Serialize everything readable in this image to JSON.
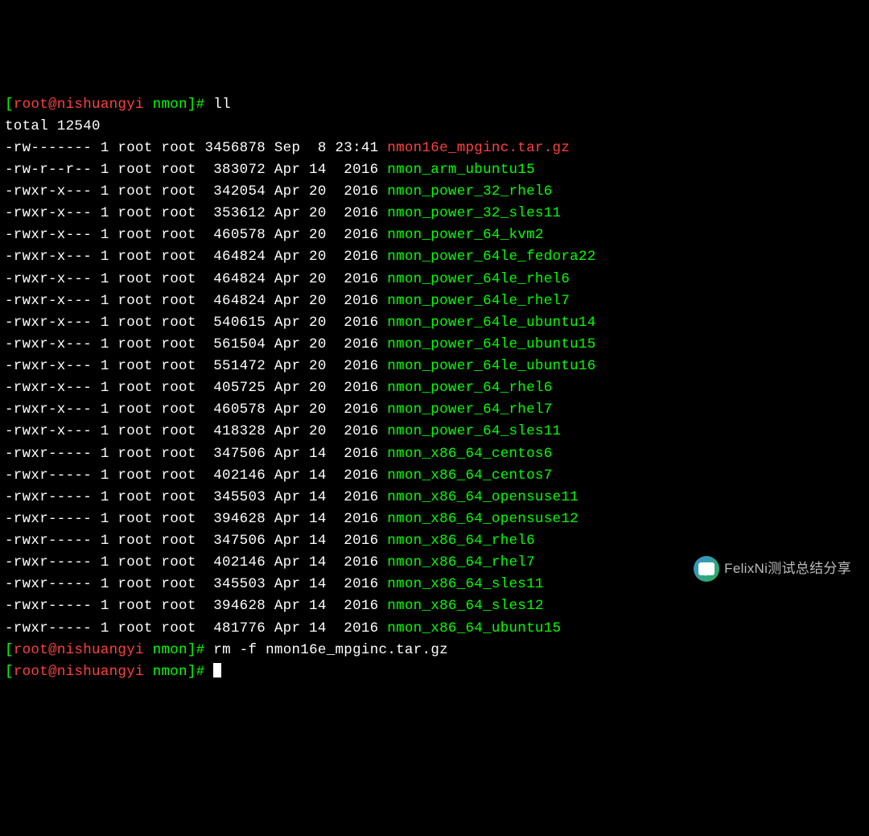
{
  "prompt1_user": "root@nishuangyi",
  "prompt1_dir": "nmon",
  "prompt1_symbol": "#",
  "cmd1": "ll",
  "total_line": "total 12540",
  "files": [
    {
      "perm": "-rw-------",
      "links": "1",
      "owner": "root",
      "group": "root",
      "size": "3456878",
      "month": "Sep",
      "day": " 8",
      "time": "23:41",
      "name": "nmon16e_mpginc.tar.gz",
      "color": "red-file"
    },
    {
      "perm": "-rw-r--r--",
      "links": "1",
      "owner": "root",
      "group": "root",
      "size": " 383072",
      "month": "Apr",
      "day": "14",
      "time": " 2016",
      "name": "nmon_arm_ubuntu15",
      "color": "green"
    },
    {
      "perm": "-rwxr-x---",
      "links": "1",
      "owner": "root",
      "group": "root",
      "size": " 342054",
      "month": "Apr",
      "day": "20",
      "time": " 2016",
      "name": "nmon_power_32_rhel6",
      "color": "green"
    },
    {
      "perm": "-rwxr-x---",
      "links": "1",
      "owner": "root",
      "group": "root",
      "size": " 353612",
      "month": "Apr",
      "day": "20",
      "time": " 2016",
      "name": "nmon_power_32_sles11",
      "color": "green"
    },
    {
      "perm": "-rwxr-x---",
      "links": "1",
      "owner": "root",
      "group": "root",
      "size": " 460578",
      "month": "Apr",
      "day": "20",
      "time": " 2016",
      "name": "nmon_power_64_kvm2",
      "color": "green"
    },
    {
      "perm": "-rwxr-x---",
      "links": "1",
      "owner": "root",
      "group": "root",
      "size": " 464824",
      "month": "Apr",
      "day": "20",
      "time": " 2016",
      "name": "nmon_power_64le_fedora22",
      "color": "green"
    },
    {
      "perm": "-rwxr-x---",
      "links": "1",
      "owner": "root",
      "group": "root",
      "size": " 464824",
      "month": "Apr",
      "day": "20",
      "time": " 2016",
      "name": "nmon_power_64le_rhel6",
      "color": "green"
    },
    {
      "perm": "-rwxr-x---",
      "links": "1",
      "owner": "root",
      "group": "root",
      "size": " 464824",
      "month": "Apr",
      "day": "20",
      "time": " 2016",
      "name": "nmon_power_64le_rhel7",
      "color": "green"
    },
    {
      "perm": "-rwxr-x---",
      "links": "1",
      "owner": "root",
      "group": "root",
      "size": " 540615",
      "month": "Apr",
      "day": "20",
      "time": " 2016",
      "name": "nmon_power_64le_ubuntu14",
      "color": "green"
    },
    {
      "perm": "-rwxr-x---",
      "links": "1",
      "owner": "root",
      "group": "root",
      "size": " 561504",
      "month": "Apr",
      "day": "20",
      "time": " 2016",
      "name": "nmon_power_64le_ubuntu15",
      "color": "green"
    },
    {
      "perm": "-rwxr-x---",
      "links": "1",
      "owner": "root",
      "group": "root",
      "size": " 551472",
      "month": "Apr",
      "day": "20",
      "time": " 2016",
      "name": "nmon_power_64le_ubuntu16",
      "color": "green"
    },
    {
      "perm": "-rwxr-x---",
      "links": "1",
      "owner": "root",
      "group": "root",
      "size": " 405725",
      "month": "Apr",
      "day": "20",
      "time": " 2016",
      "name": "nmon_power_64_rhel6",
      "color": "green"
    },
    {
      "perm": "-rwxr-x---",
      "links": "1",
      "owner": "root",
      "group": "root",
      "size": " 460578",
      "month": "Apr",
      "day": "20",
      "time": " 2016",
      "name": "nmon_power_64_rhel7",
      "color": "green"
    },
    {
      "perm": "-rwxr-x---",
      "links": "1",
      "owner": "root",
      "group": "root",
      "size": " 418328",
      "month": "Apr",
      "day": "20",
      "time": " 2016",
      "name": "nmon_power_64_sles11",
      "color": "green"
    },
    {
      "perm": "-rwxr-----",
      "links": "1",
      "owner": "root",
      "group": "root",
      "size": " 347506",
      "month": "Apr",
      "day": "14",
      "time": " 2016",
      "name": "nmon_x86_64_centos6",
      "color": "green"
    },
    {
      "perm": "-rwxr-----",
      "links": "1",
      "owner": "root",
      "group": "root",
      "size": " 402146",
      "month": "Apr",
      "day": "14",
      "time": " 2016",
      "name": "nmon_x86_64_centos7",
      "color": "green"
    },
    {
      "perm": "-rwxr-----",
      "links": "1",
      "owner": "root",
      "group": "root",
      "size": " 345503",
      "month": "Apr",
      "day": "14",
      "time": " 2016",
      "name": "nmon_x86_64_opensuse11",
      "color": "green"
    },
    {
      "perm": "-rwxr-----",
      "links": "1",
      "owner": "root",
      "group": "root",
      "size": " 394628",
      "month": "Apr",
      "day": "14",
      "time": " 2016",
      "name": "nmon_x86_64_opensuse12",
      "color": "green"
    },
    {
      "perm": "-rwxr-----",
      "links": "1",
      "owner": "root",
      "group": "root",
      "size": " 347506",
      "month": "Apr",
      "day": "14",
      "time": " 2016",
      "name": "nmon_x86_64_rhel6",
      "color": "green"
    },
    {
      "perm": "-rwxr-----",
      "links": "1",
      "owner": "root",
      "group": "root",
      "size": " 402146",
      "month": "Apr",
      "day": "14",
      "time": " 2016",
      "name": "nmon_x86_64_rhel7",
      "color": "green"
    },
    {
      "perm": "-rwxr-----",
      "links": "1",
      "owner": "root",
      "group": "root",
      "size": " 345503",
      "month": "Apr",
      "day": "14",
      "time": " 2016",
      "name": "nmon_x86_64_sles11",
      "color": "green"
    },
    {
      "perm": "-rwxr-----",
      "links": "1",
      "owner": "root",
      "group": "root",
      "size": " 394628",
      "month": "Apr",
      "day": "14",
      "time": " 2016",
      "name": "nmon_x86_64_sles12",
      "color": "green"
    },
    {
      "perm": "-rwxr-----",
      "links": "1",
      "owner": "root",
      "group": "root",
      "size": " 481776",
      "month": "Apr",
      "day": "14",
      "time": " 2016",
      "name": "nmon_x86_64_ubuntu15",
      "color": "green"
    }
  ],
  "cmd2": "rm -f nmon16e_mpginc.tar.gz",
  "watermark": "FelixNi测试总结分享"
}
